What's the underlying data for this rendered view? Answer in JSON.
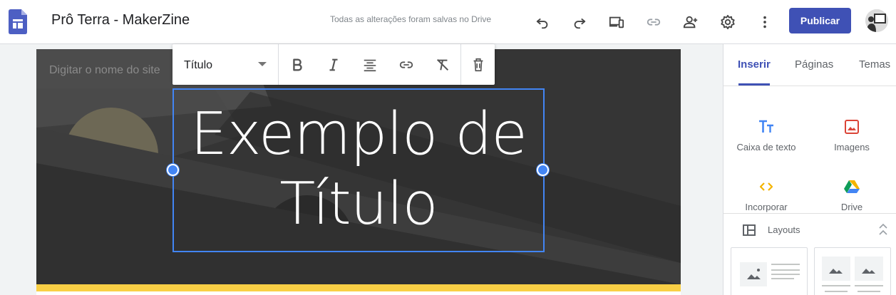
{
  "app": {
    "title": "Prô Terra - MakerZine",
    "save_status": "Todas as alterações foram salvas no Drive",
    "publish_label": "Publicar",
    "accent_color": "#3f51b5"
  },
  "toolbar_icons": [
    "undo-icon",
    "redo-icon",
    "preview-icon",
    "link-icon",
    "share-icon",
    "settings-icon",
    "more-icon"
  ],
  "site": {
    "name_placeholder": "Digitar o nome do site",
    "title_line1": "Exemplo de",
    "title_line2": "Título"
  },
  "format_toolbar": {
    "style_value": "Título",
    "buttons": [
      "bold-icon",
      "italic-icon",
      "align-center-icon",
      "link-icon",
      "clear-format-icon",
      "delete-icon"
    ]
  },
  "panel": {
    "tabs": [
      {
        "label": "Inserir",
        "active": true
      },
      {
        "label": "Páginas",
        "active": false
      },
      {
        "label": "Temas",
        "active": false
      }
    ],
    "insert_items": [
      {
        "label": "Caixa de texto",
        "icon": "text-box-icon",
        "color": "#4285f4"
      },
      {
        "label": "Imagens",
        "icon": "image-icon",
        "color": "#db4437"
      },
      {
        "label": "Incorporar",
        "icon": "embed-icon",
        "color": "#f4b400"
      },
      {
        "label": "Drive",
        "icon": "drive-icon",
        "color": "#0f9d58"
      }
    ],
    "layouts_label": "Layouts"
  }
}
